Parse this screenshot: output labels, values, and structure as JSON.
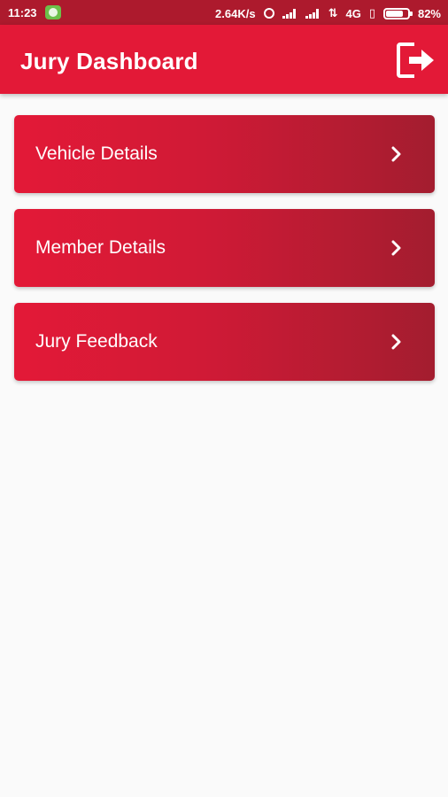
{
  "status_bar": {
    "time": "11:23",
    "network_speed": "2.64K/s",
    "network_type": "4G",
    "battery": "82%",
    "battery_level": 0.82,
    "icons": [
      "whatsapp-icon",
      "alarm-icon",
      "signal-icon",
      "signal-icon",
      "data-arrows-icon",
      "vibrate-icon",
      "battery-icon"
    ]
  },
  "app_bar": {
    "title": "Jury Dashboard",
    "logout_icon": "logout-icon"
  },
  "menu": {
    "items": [
      {
        "label": "Vehicle Details",
        "icon": "chevron-right-icon"
      },
      {
        "label": "Member Details",
        "icon": "chevron-right-icon"
      },
      {
        "label": "Jury Feedback",
        "icon": "chevron-right-icon"
      }
    ]
  },
  "colors": {
    "status_bar": "#ad1a2d",
    "primary": "#e31937",
    "card_gradient_start": "#e31937",
    "card_gradient_end": "#a31d2f",
    "background": "#fafafa",
    "text_on_primary": "#ffffff"
  }
}
